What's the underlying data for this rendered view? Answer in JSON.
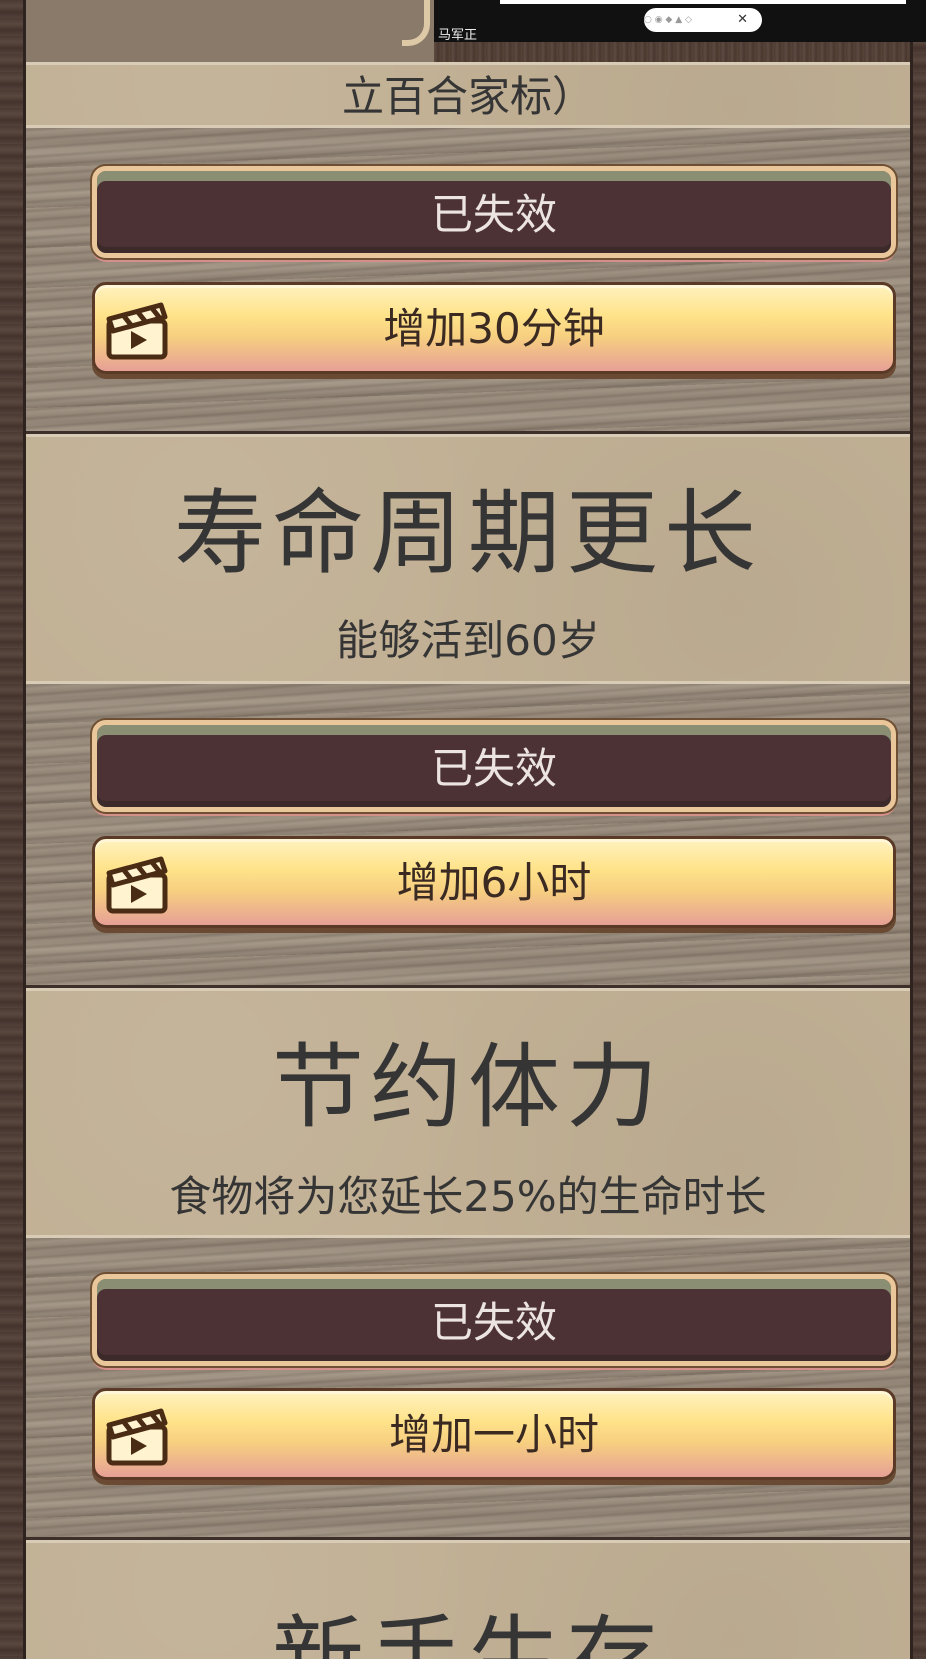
{
  "overlay": {
    "label": "马军正",
    "pill_icons": "○ ◉ ◆ ▲ ◇",
    "close": "✕"
  },
  "cards": [
    {
      "title": "",
      "desc": "立百合家标）",
      "disabled_label": "已失效",
      "action_label": "增加30分钟"
    },
    {
      "title": "寿命周期更长",
      "desc": "能够活到60岁",
      "disabled_label": "已失效",
      "action_label": "增加6小时"
    },
    {
      "title": "节约体力",
      "desc": "食物将为您延长25%的生命时长",
      "disabled_label": "已失效",
      "action_label": "增加一小时"
    },
    {
      "title": "新手生存",
      "desc": ""
    }
  ],
  "colors": {
    "parchment": "#c1b094",
    "disabled_button": "#4c3234",
    "active_button_top": "#ffe38a",
    "active_button_bottom": "#e6a096",
    "text": "#353535"
  },
  "icons": {
    "action_button_icon": "clapperboard-icon"
  }
}
